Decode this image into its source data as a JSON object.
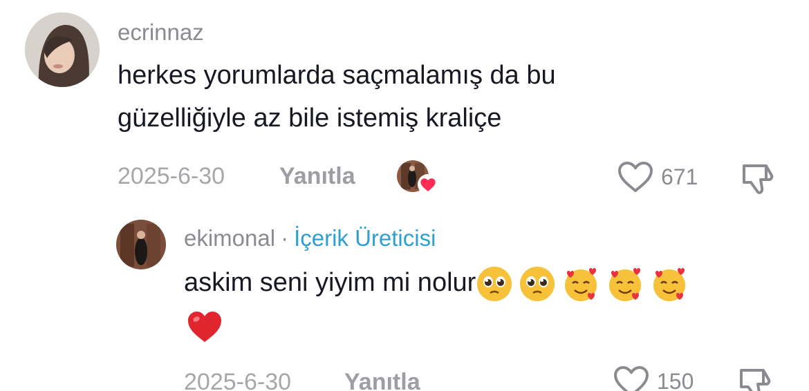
{
  "comment": {
    "username": "ecrinnaz",
    "text_line1": "herkes yorumlarda saçmalamış da bu",
    "text_line2": "güzelliğiyle az bile istemiş kraliçe",
    "date": "2025-6-30",
    "reply_label": "Yanıtla",
    "like_count": "671"
  },
  "reply": {
    "username": "ekimonal",
    "separator": "·",
    "badge": "İçerik Üreticisi",
    "text": "askim seni yiyim mi nolur",
    "emojis": [
      "pleading-face",
      "pleading-face",
      "smiling-face-with-hearts",
      "smiling-face-with-hearts",
      "smiling-face-with-hearts",
      "red-heart"
    ],
    "date": "2025-6-30",
    "reply_label": "Yanıtla",
    "like_count": "150"
  },
  "icons": {
    "like": "heart-outline-icon",
    "dislike": "thumbs-down-icon",
    "creator_liked": "creator-liked-avatar-icon"
  },
  "colors": {
    "text": "#161823",
    "muted": "#8a8b91",
    "badge": "#2d9fd3",
    "heart": "#fe2c55"
  }
}
